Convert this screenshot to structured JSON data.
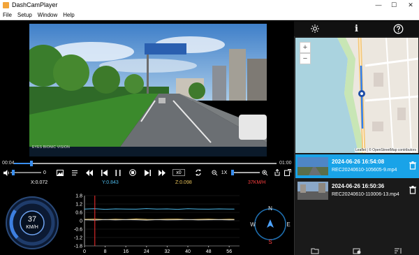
{
  "window": {
    "title": "DashCamPlayer",
    "controls": {
      "minimize": "—",
      "maximize": "☐",
      "close": "✕"
    }
  },
  "menu": {
    "items": [
      "File",
      "Setup",
      "Window",
      "Help"
    ]
  },
  "video": {
    "watermark": "EYES BIONIC VISION"
  },
  "right_toolbar": {
    "info_label": "i"
  },
  "map": {
    "zoom_in": "+",
    "zoom_out": "−",
    "attribution": "Leaflet | © OpenStreetMap contributors"
  },
  "files": [
    {
      "timestamp": "2024-06-26 16:54:08",
      "filename": "REC20240610-105605-9.mp4",
      "selected": true
    },
    {
      "timestamp": "2024-06-26 16:50:36",
      "filename": "REC20240610-110006-13.mp4",
      "selected": false
    }
  ],
  "playback": {
    "current_time": "00:04",
    "total_time": "01:00",
    "progress": 0.067,
    "volume_label": "0",
    "volume": 0.1,
    "speed_label": "x0",
    "zoom_label": "1X"
  },
  "sensors": {
    "x": "X:0.072",
    "y": "Y:0.843",
    "z": "Z:0.098",
    "speed": "37KM/H",
    "colors": {
      "x": "#ffffff",
      "y": "#4db8e8",
      "z": "#e8c25a",
      "speed": "#ff4040"
    }
  },
  "speedometer": {
    "value": "37",
    "unit": "KM/H",
    "fraction": 0.3
  },
  "compass": {
    "n": "N",
    "s": "S",
    "e": "E",
    "w": "W"
  },
  "chart_data": {
    "type": "line",
    "x_ticks": [
      "0",
      "8",
      "16",
      "24",
      "32",
      "40",
      "48",
      "56"
    ],
    "y_ticks": [
      "1.8",
      "1.2",
      "0.6",
      "0",
      "-0.6",
      "-1.2",
      "-1.8"
    ],
    "ylim": [
      -1.8,
      1.8
    ],
    "xlim": [
      0,
      60
    ],
    "cursor_x": 4,
    "series": [
      {
        "color": "#4db8e8",
        "x": [
          0,
          4,
          8,
          12,
          16,
          20,
          24,
          28,
          32,
          36,
          40,
          44,
          48,
          52,
          56,
          58
        ],
        "y": [
          0.84,
          0.86,
          0.82,
          0.85,
          0.84,
          0.83,
          0.87,
          0.84,
          0.85,
          0.82,
          0.86,
          0.84,
          0.83,
          0.85,
          0.84,
          0.84
        ]
      },
      {
        "color": "#e8c25a",
        "x": [
          0,
          4,
          8,
          12,
          16,
          20,
          24,
          28,
          32,
          36,
          40,
          44,
          48,
          52,
          56,
          58
        ],
        "y": [
          0.1,
          0.12,
          0.08,
          0.11,
          0.09,
          0.13,
          0.1,
          0.09,
          0.11,
          0.12,
          0.08,
          0.1,
          0.12,
          0.09,
          0.11,
          0.1
        ]
      },
      {
        "color": "#d0d0d0",
        "x": [
          0,
          4,
          8,
          12,
          16,
          20,
          24,
          28,
          32,
          36,
          40,
          44,
          48,
          52,
          56,
          58
        ],
        "y": [
          0.07,
          0.05,
          0.09,
          0.06,
          0.08,
          0.07,
          0.05,
          0.08,
          0.06,
          0.07,
          0.09,
          0.06,
          0.07,
          0.08,
          0.06,
          0.07
        ]
      }
    ]
  }
}
